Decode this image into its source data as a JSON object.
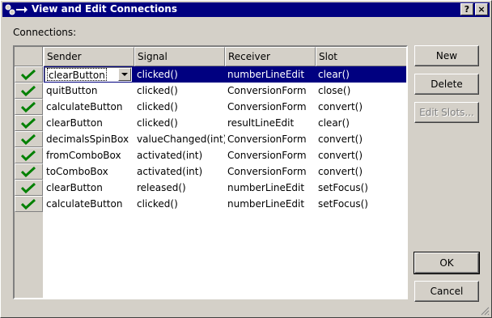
{
  "window": {
    "title": "View and Edit Connections",
    "help_glyph": "?",
    "close_glyph": "×"
  },
  "connections_label": "Connections:",
  "table": {
    "columns": [
      "Sender",
      "Signal",
      "Receiver",
      "Slot"
    ],
    "rows": [
      {
        "sender": "clearButton",
        "signal": "clicked()",
        "receiver": "numberLineEdit",
        "slot": "clear()",
        "selected": true,
        "checked": true
      },
      {
        "sender": "quitButton",
        "signal": "clicked()",
        "receiver": "ConversionForm",
        "slot": "close()",
        "checked": true
      },
      {
        "sender": "calculateButton",
        "signal": "clicked()",
        "receiver": "ConversionForm",
        "slot": "convert()",
        "checked": true
      },
      {
        "sender": "clearButton",
        "signal": "clicked()",
        "receiver": "resultLineEdit",
        "slot": "clear()",
        "checked": true
      },
      {
        "sender": "decimalsSpinBox",
        "signal": "valueChanged(int)",
        "receiver": "ConversionForm",
        "slot": "convert()",
        "checked": true
      },
      {
        "sender": "fromComboBox",
        "signal": "activated(int)",
        "receiver": "ConversionForm",
        "slot": "convert()",
        "checked": true
      },
      {
        "sender": "toComboBox",
        "signal": "activated(int)",
        "receiver": "ConversionForm",
        "slot": "convert()",
        "checked": true
      },
      {
        "sender": "clearButton",
        "signal": "released()",
        "receiver": "numberLineEdit",
        "slot": "setFocus()",
        "checked": true
      },
      {
        "sender": "calculateButton",
        "signal": "clicked()",
        "receiver": "numberLineEdit",
        "slot": "setFocus()",
        "checked": true
      }
    ]
  },
  "buttons": {
    "new": "New",
    "delete": "Delete",
    "edit_slots": "Edit Slots...",
    "ok": "OK",
    "cancel": "Cancel"
  },
  "colors": {
    "selection": "#000080",
    "check": "#008000",
    "face": "#d4d0c8"
  }
}
